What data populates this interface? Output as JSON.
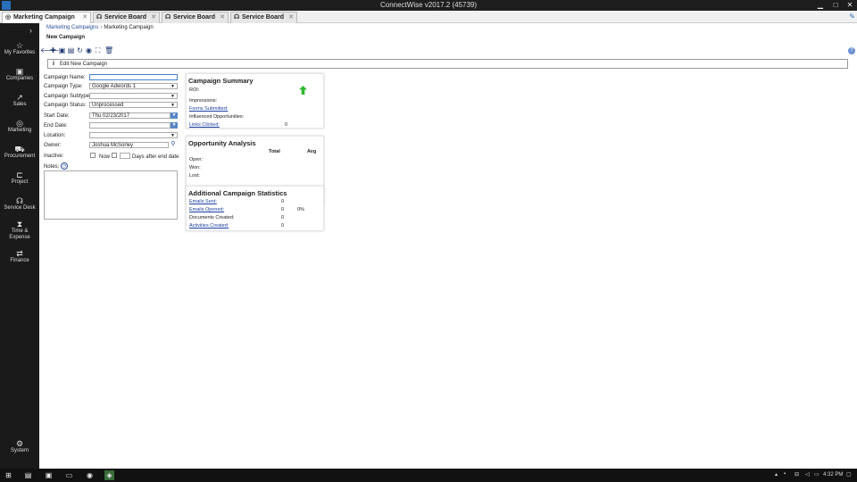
{
  "window": {
    "title": "ConnectWise v2017.2 (45739)",
    "minimize": "▁",
    "maximize": "□",
    "close": "✕"
  },
  "tabs": [
    {
      "label": "Marketing Campaign",
      "icon": "target-icon",
      "close": "✕"
    },
    {
      "label": "Service Board",
      "icon": "headset-icon",
      "close": "✕"
    },
    {
      "label": "Service Board",
      "icon": "headset-icon",
      "close": "✕"
    },
    {
      "label": "Service Board",
      "icon": "headset-icon",
      "close": "✕"
    }
  ],
  "sidebar": {
    "items": [
      {
        "label": "My Favorites",
        "icon": "star-icon",
        "glyph": "☆"
      },
      {
        "label": "Companies",
        "icon": "building-icon",
        "glyph": "▣"
      },
      {
        "label": "Sales",
        "icon": "chart-icon",
        "glyph": "↗"
      },
      {
        "label": "Marketing",
        "icon": "target-icon",
        "glyph": "◎"
      },
      {
        "label": "Procurement",
        "icon": "cart-icon",
        "glyph": "⛟"
      },
      {
        "label": "Project",
        "icon": "project-icon",
        "glyph": "⊏"
      },
      {
        "label": "Service Desk",
        "icon": "headset-icon",
        "glyph": "☊"
      },
      {
        "label": "Time &",
        "label2": "Expense",
        "icon": "clock-icon",
        "glyph": "⧗"
      },
      {
        "label": "Finance",
        "icon": "sliders-icon",
        "glyph": "⇄"
      }
    ],
    "system": {
      "label": "System",
      "icon": "gear-icon",
      "glyph": "⚙"
    }
  },
  "breadcrumb": {
    "parent": "Marketing Campaigns",
    "current": "Marketing Campaign"
  },
  "page_title": "New Campaign",
  "section_title": "Edit New Campaign",
  "form": {
    "campaign_name": {
      "label": "Campaign Name:",
      "value": ""
    },
    "campaign_type": {
      "label": "Campaign Type:",
      "value": "Google Adwords 1"
    },
    "campaign_subtype": {
      "label": "Campaign Subtype:",
      "value": ""
    },
    "campaign_status": {
      "label": "Campaign Status:",
      "value": "Unprocessed"
    },
    "start_date": {
      "label": "Start Date:",
      "value": "Thu 02/23/2017"
    },
    "end_date": {
      "label": "End Date:",
      "value": ""
    },
    "location": {
      "label": "Location:",
      "value": ""
    },
    "owner": {
      "label": "Owner:",
      "value": "Joshua McSorley"
    },
    "inactive": {
      "label": "Inactive:",
      "now": "Now",
      "days": "Days after end date"
    },
    "notes": {
      "label": "Notes:"
    }
  },
  "campaign_summary": {
    "title": "Campaign Summary",
    "roi": "ROI:",
    "impressions": "Impressions:",
    "forms_submitted": "Forms Submitted:",
    "influenced": "Influenced Opportunities:",
    "links_clicked": "Links Clicked:",
    "links_clicked_value": "0"
  },
  "opportunity_analysis": {
    "title": "Opportunity Analysis",
    "col_total": "Total",
    "col_avg": "Avg",
    "open": "Open:",
    "won": "Won:",
    "lost": "Lost:"
  },
  "additional_stats": {
    "title": "Additional Campaign Statistics",
    "emails_sent": "Emails Sent:",
    "emails_sent_value": "0",
    "emails_opened": "Emails Opened:",
    "emails_opened_value": "0",
    "emails_opened_pct": "0%",
    "documents_created": "Documents Created:",
    "documents_created_value": "0",
    "activities_created": "Activities Created:",
    "activities_created_value": "0"
  },
  "taskbar": {
    "time": "4:32 PM"
  },
  "colors": {
    "sidebar_bg": "#1a1a1a",
    "link": "#1a3fa0",
    "arrow_up": "#2eb82e"
  }
}
